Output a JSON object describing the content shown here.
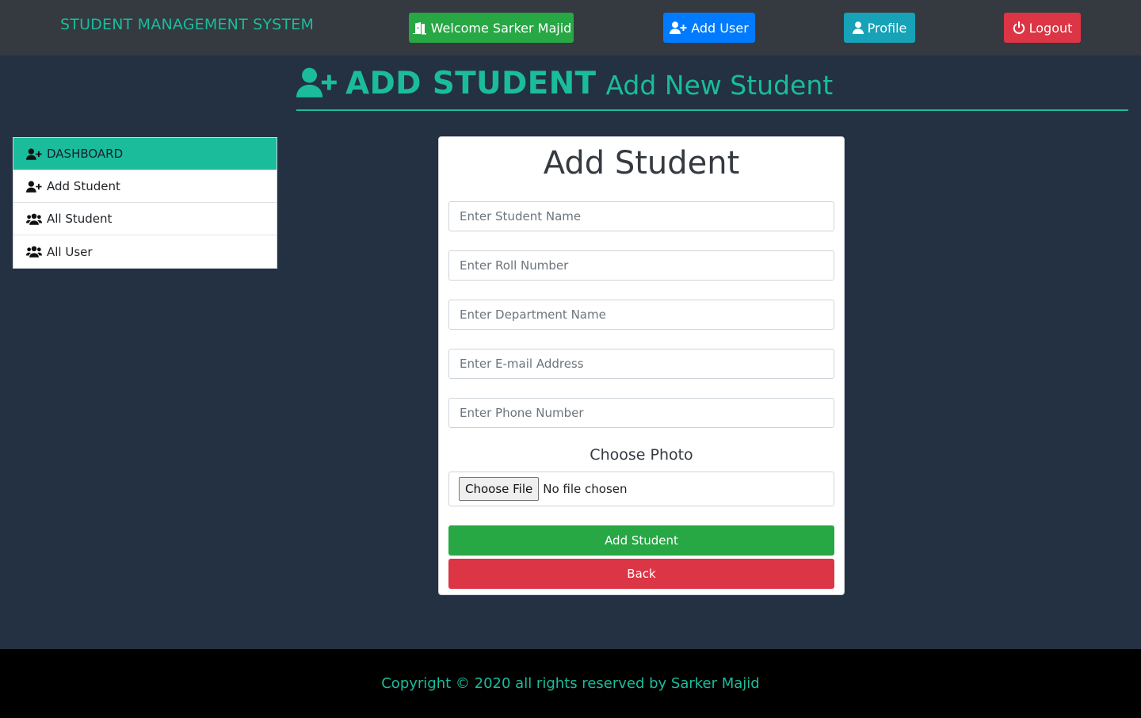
{
  "navbar": {
    "brand": "STUDENT MANAGEMENT SYSTEM",
    "welcome_label": "Welcome Sarker Majid",
    "add_user_label": "Add User",
    "profile_label": "Profile",
    "logout_label": "Logout"
  },
  "heading": {
    "title": "ADD STUDENT",
    "subtitle": "Add New Student"
  },
  "sidebar": {
    "items": [
      {
        "label": "DASHBOARD",
        "icon": "user-plus-icon",
        "active": true
      },
      {
        "label": "Add Student",
        "icon": "user-plus-icon"
      },
      {
        "label": "All Student",
        "icon": "users-icon"
      },
      {
        "label": "All User",
        "icon": "users-icon"
      }
    ]
  },
  "form": {
    "title": "Add Student",
    "fields": {
      "name_placeholder": "Enter Student Name",
      "roll_placeholder": "Enter Roll Number",
      "department_placeholder": "Enter Department Name",
      "email_placeholder": "Enter E-mail Address",
      "phone_placeholder": "Enter Phone Number"
    },
    "photo_label": "Choose Photo",
    "choose_file_label": "Choose File",
    "no_file_text": "No file chosen",
    "submit_label": "Add Student",
    "back_label": "Back"
  },
  "footer": {
    "copyright": "Copyright © 2020 all rights reserved by Sarker Majid"
  },
  "colors": {
    "accent": "#1abc9c",
    "background": "#233142",
    "success": "#28a745",
    "primary": "#007bff",
    "info": "#17a2b8",
    "danger": "#dc3545"
  }
}
